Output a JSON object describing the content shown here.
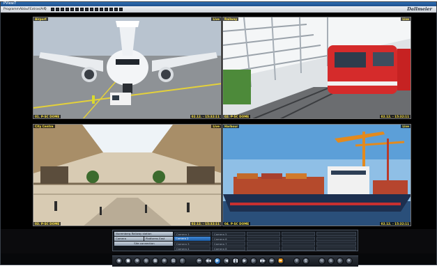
{
  "app": {
    "title": "PView7",
    "brand": "Dallmeier",
    "menu": [
      "Programm",
      "Ablauf",
      "Extras/ArQ",
      "?"
    ]
  },
  "cameras": [
    {
      "name": "Airport",
      "status": "Live",
      "source": "01. P-SC DOME",
      "timestamp": "02.12. - 15:32:11"
    },
    {
      "name": "Railway",
      "status": "Live",
      "source": "02. P-SC DOME",
      "timestamp": "02.12. - 15:32:11"
    },
    {
      "name": "City Centre",
      "status": "Live",
      "source": "03. P-SC DOME",
      "timestamp": "02.12. - 15:32:11"
    },
    {
      "name": "Harbour",
      "status": "Live",
      "source": "04. P-SC DOME",
      "timestamp": "02.12. - 15:32:11"
    }
  ],
  "panel": {
    "location": "Nuremberg Railway station",
    "col_a": "Camera",
    "col_b": "Platforms East",
    "group": "Site connection",
    "cameras": [
      "Camera 1",
      "Camera 2",
      "Camera 3",
      "Camera 4",
      "Camera 5",
      "Camera 6",
      "Camera 7",
      "Camera 8"
    ]
  },
  "colors": {
    "overlay_text": "#ffe74a",
    "selection": "#2a6fc4",
    "titlebar": "#2f6fb3"
  }
}
